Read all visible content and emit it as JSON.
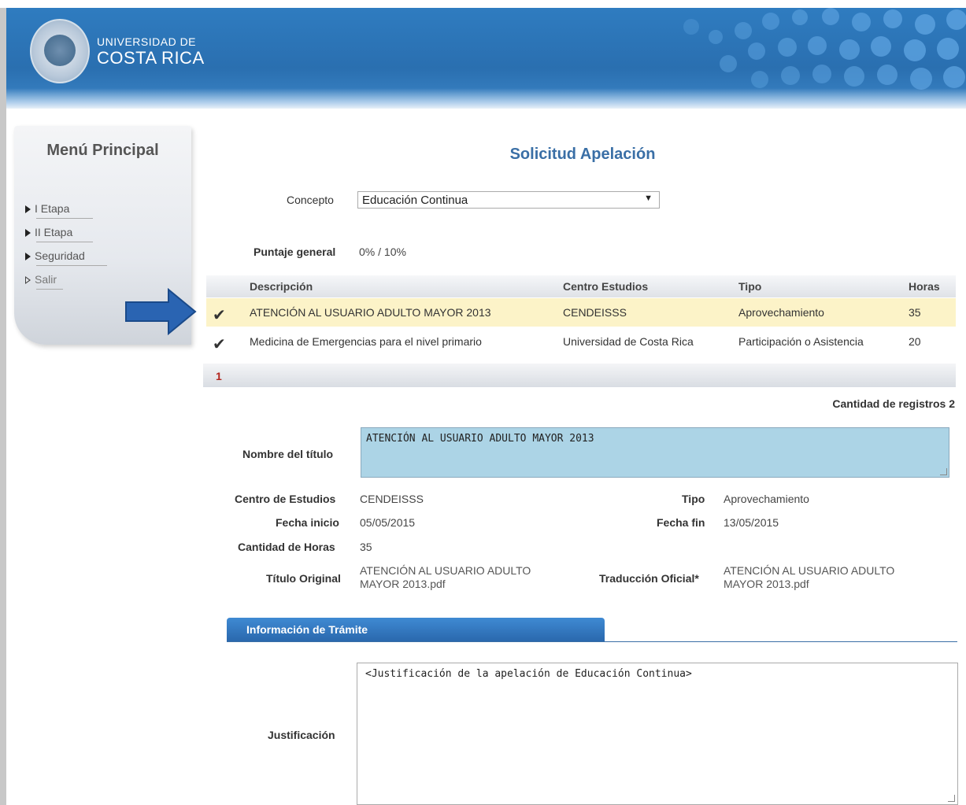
{
  "header": {
    "brand_line1": "UNIVERSIDAD DE",
    "brand_line2": "COSTA RICA"
  },
  "sidebar": {
    "title": "Menú Principal",
    "items": [
      {
        "label": "I Etapa"
      },
      {
        "label": "II Etapa"
      },
      {
        "label": "Seguridad"
      },
      {
        "label": "Salir"
      }
    ]
  },
  "page": {
    "title": "Solicitud Apelación",
    "concepto_label": "Concepto",
    "concepto_value": "Educación Continua",
    "puntaje_label": "Puntaje general",
    "puntaje_value": "0% / 10%"
  },
  "table": {
    "headers": [
      "Descripción",
      "Centro Estudios",
      "Tipo",
      "Horas"
    ],
    "rows": [
      [
        "ATENCIÓN AL USUARIO ADULTO MAYOR 2013",
        "CENDEISSS",
        "Aprovechamiento",
        "35"
      ],
      [
        "Medicina de Emergencias para el nivel primario",
        "Universidad de Costa Rica",
        "Participación o Asistencia",
        "20"
      ]
    ],
    "page": "1",
    "count_label": "Cantidad de registros 2"
  },
  "detail": {
    "nombre_label": "Nombre del título",
    "nombre_value": "ATENCIÓN AL USUARIO ADULTO MAYOR 2013",
    "centro_label": "Centro de Estudios",
    "centro_value": "CENDEISSS",
    "tipo_label": "Tipo",
    "tipo_value": "Aprovechamiento",
    "fecha_inicio_label": "Fecha inicio",
    "fecha_inicio_value": "05/05/2015",
    "fecha_fin_label": "Fecha fin",
    "fecha_fin_value": "13/05/2015",
    "horas_label": "Cantidad de Horas",
    "horas_value": "35",
    "titulo_original_label": "Título Original",
    "titulo_original_line1": "ATENCIÓN AL USUARIO ADULTO",
    "titulo_original_line2": "MAYOR 2013.pdf",
    "traduccion_label": "Traducción Oficial*",
    "traduccion_line1": "ATENCIÓN AL USUARIO ADULTO",
    "traduccion_line2": "MAYOR 2013.pdf"
  },
  "tramite": {
    "tab_label": "Información de Trámite",
    "justificacion_label": "Justificación",
    "justificacion_value": "<Justificación de la apelación de Educación Continua>"
  },
  "colors": {
    "header_blue": "#2f7cc0",
    "title_blue": "#3a6fa6",
    "selected_row": "#fcf3c8",
    "textarea_blue": "#acd4e6",
    "pager_red": "#b3261e"
  }
}
